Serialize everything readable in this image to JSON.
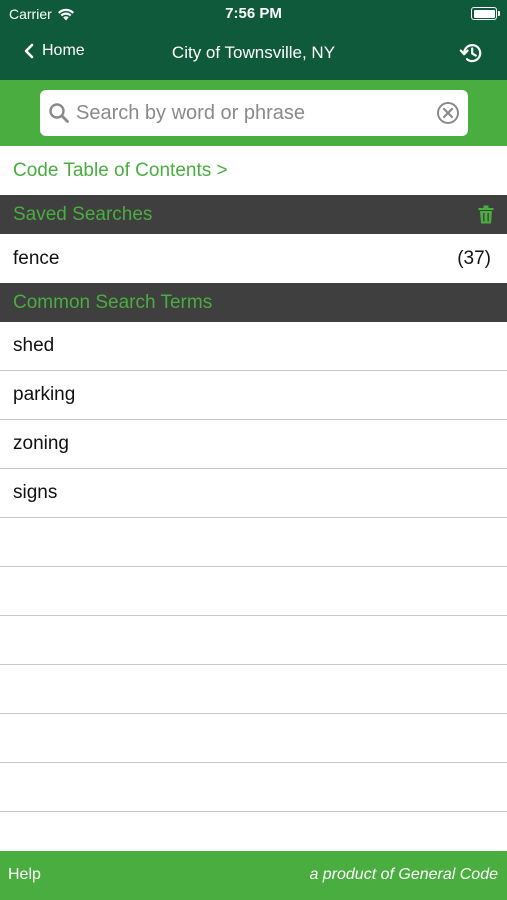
{
  "status_bar": {
    "carrier": "Carrier",
    "time": "7:56 PM"
  },
  "nav": {
    "back_label": "Home",
    "title": "City of Townsville, NY"
  },
  "search": {
    "placeholder": "Search by word or phrase",
    "value": ""
  },
  "toc_link": "Code Table of Contents >",
  "saved_searches": {
    "header": "Saved Searches",
    "items": [
      {
        "term": "fence",
        "count": "(37)"
      }
    ]
  },
  "common_terms": {
    "header": "Common Search Terms",
    "items": [
      "shed",
      "parking",
      "zoning",
      "signs"
    ]
  },
  "footer": {
    "help": "Help",
    "credit": "a product of General Code"
  },
  "colors": {
    "dark_green": "#0e5a3a",
    "accent_green": "#49ad3f",
    "section_gray": "#3f3f3f"
  }
}
